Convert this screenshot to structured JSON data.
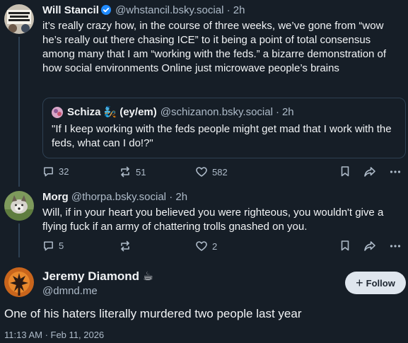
{
  "posts": [
    {
      "author_name": "Will Stancil",
      "author_handle": "@whstancil.bsky.social",
      "time": "2h",
      "verified": true,
      "text": "it’s really crazy how, in the course of three weeks, we’ve gone from “wow he’s really out there chasing ICE” to it being a point of total consensus among many that I am “working with the feds.” a bizarre demonstration of how social environments Online just microwave people’s brains",
      "quote": {
        "author_name": "Schiza",
        "author_emoji": "🧞",
        "author_pronouns": "(ey/em)",
        "author_handle": "@schizanon.bsky.social",
        "time": "2h",
        "text": "\"If I keep working with the feds people might get mad that I work with the feds, what can I do!?\""
      },
      "replies": "32",
      "reposts": "51",
      "likes": "582"
    },
    {
      "author_name": "Morg",
      "author_handle": "@thorpa.bsky.social",
      "time": "2h",
      "text": "Will, if in your heart you believed you were righteous, you wouldn't give a flying fuck if an army of chattering trolls gnashed on you.",
      "replies": "5",
      "reposts": "",
      "likes": "2"
    }
  ],
  "main_post": {
    "author_name": "Jeremy Diamond ☕",
    "author_handle": "@dmnd.me",
    "follow_label": "Follow",
    "text": "One of his haters literally murdered two people last year",
    "timestamp": "11:13 AM · Feb 11, 2026"
  },
  "dot": "·",
  "colors": {
    "background": "#161e27",
    "text_primary": "#f1f3f5",
    "text_secondary": "#aebbc9",
    "verified": "#208bfe",
    "follow_button": "#dfe6ee"
  },
  "icons": [
    "verified-icon",
    "reply-icon",
    "repost-icon",
    "like-icon",
    "bookmark-icon",
    "share-icon",
    "more-icon",
    "plus-icon"
  ]
}
